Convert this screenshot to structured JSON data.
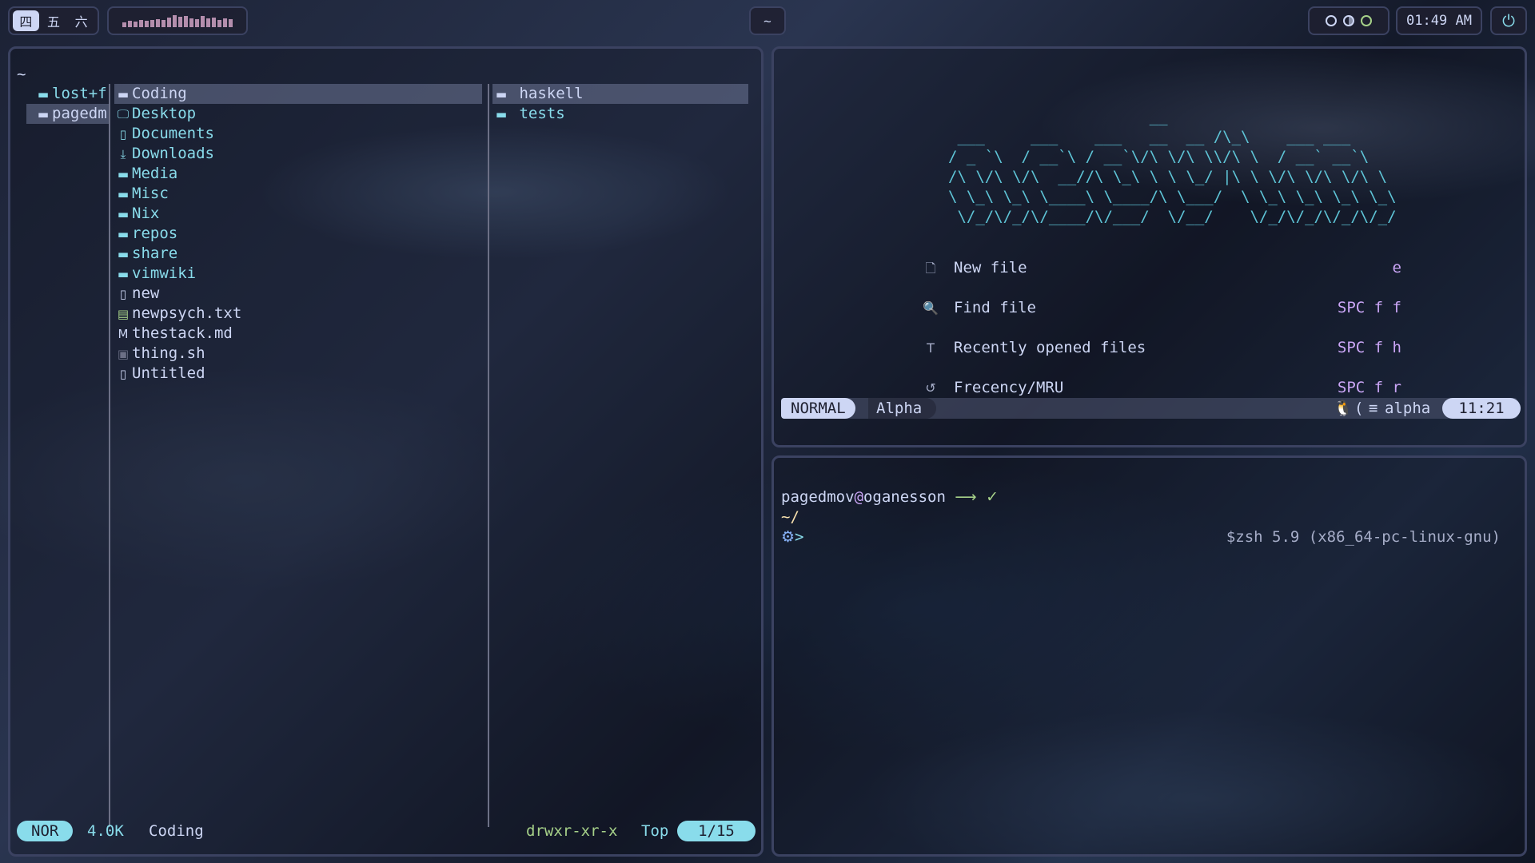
{
  "topbar": {
    "workspaces": [
      "四",
      "五",
      "六"
    ],
    "active_workspace": 0,
    "visualizer_levels": [
      0.2,
      0.3,
      0.25,
      0.4,
      0.35,
      0.45,
      0.5,
      0.4,
      0.7,
      0.9,
      0.75,
      0.85,
      0.6,
      0.5,
      0.8,
      0.55,
      0.7,
      0.4,
      0.6,
      0.5
    ],
    "window_title": "~",
    "clock": "01:49 AM",
    "power_glyph": "⏻"
  },
  "file_manager": {
    "path": "~",
    "parent": [
      {
        "name": "lost+f",
        "type": "dir"
      },
      {
        "name": "pagedm",
        "type": "dir",
        "selected": true
      }
    ],
    "current": [
      {
        "name": "Coding",
        "type": "dir",
        "icon": "folder-icon",
        "selected": true
      },
      {
        "name": "Desktop",
        "type": "dir",
        "icon": "desktop-icon"
      },
      {
        "name": "Documents",
        "type": "dir",
        "icon": "documents-icon"
      },
      {
        "name": "Downloads",
        "type": "dir",
        "icon": "downloads-icon"
      },
      {
        "name": "Media",
        "type": "dir",
        "icon": "folder-icon"
      },
      {
        "name": "Misc",
        "type": "dir",
        "icon": "folder-icon"
      },
      {
        "name": "Nix",
        "type": "dir",
        "icon": "folder-icon"
      },
      {
        "name": "repos",
        "type": "dir",
        "icon": "folder-icon"
      },
      {
        "name": "share",
        "type": "dir",
        "icon": "folder-icon"
      },
      {
        "name": "vimwiki",
        "type": "dir",
        "icon": "folder-icon"
      },
      {
        "name": "new",
        "type": "file",
        "icon": "file-icon"
      },
      {
        "name": "newpsych.txt",
        "type": "file",
        "icon": "text-file-icon"
      },
      {
        "name": "thestack.md",
        "type": "file",
        "icon": "markdown-icon"
      },
      {
        "name": "thing.sh",
        "type": "file",
        "icon": "terminal-icon"
      },
      {
        "name": "Untitled",
        "type": "file",
        "icon": "file-icon"
      }
    ],
    "preview": [
      {
        "name": "haskell",
        "type": "dir",
        "selected": true
      },
      {
        "name": "tests",
        "type": "dir"
      }
    ],
    "status": {
      "mode": "NOR",
      "size": "4.0K",
      "name": "Coding",
      "permissions": "drwxr-xr-x",
      "position": "Top",
      "count": "1/15"
    }
  },
  "editor": {
    "ascii_art": "                      __\n ___     ___    ___   __  __ /\\_\\    ___ ___\n/ _ `\\  / __`\\ / __`\\/\\ \\/\\ \\\\/\\ \\  / __` __`\\\n/\\ \\/\\ \\/\\  __//\\ \\_\\ \\ \\ \\_/ |\\ \\ \\/\\ \\/\\ \\/\\ \\\n\\ \\_\\ \\_\\ \\____\\ \\____/\\ \\___/  \\ \\_\\ \\_\\ \\_\\ \\_\\\n \\/_/\\/_/\\/____/\\/___/  \\/__/    \\/_/\\/_/\\/_/\\/_/",
    "menu": [
      {
        "icon": "new-file-icon",
        "glyph": "🗋",
        "label": "New file",
        "key": "e"
      },
      {
        "icon": "find-file-icon",
        "glyph": "🔍",
        "label": "Find file",
        "key": "SPC f f"
      },
      {
        "icon": "recent-files-icon",
        "glyph": "T",
        "label": "Recently opened files",
        "key": "SPC f h"
      },
      {
        "icon": "history-icon",
        "glyph": "↺",
        "label": "Frecency/MRU",
        "key": "SPC f r"
      }
    ],
    "statusline": {
      "mode": "NORMAL",
      "buffer": "Alpha",
      "filetype": "alpha",
      "position": "11:21"
    }
  },
  "terminal": {
    "user": "pagedmov",
    "at": "@",
    "host": "oganesson",
    "arrow": "⟶",
    "check": "✓",
    "cwd": "~/",
    "prompt": ">",
    "rprompt": "$zsh 5.9 (x86_64-pc-linux-gnu)"
  },
  "colors": {
    "accent": "#89dceb",
    "purple": "#cba6f7",
    "green": "#a6d189",
    "border": "#3b4261"
  }
}
